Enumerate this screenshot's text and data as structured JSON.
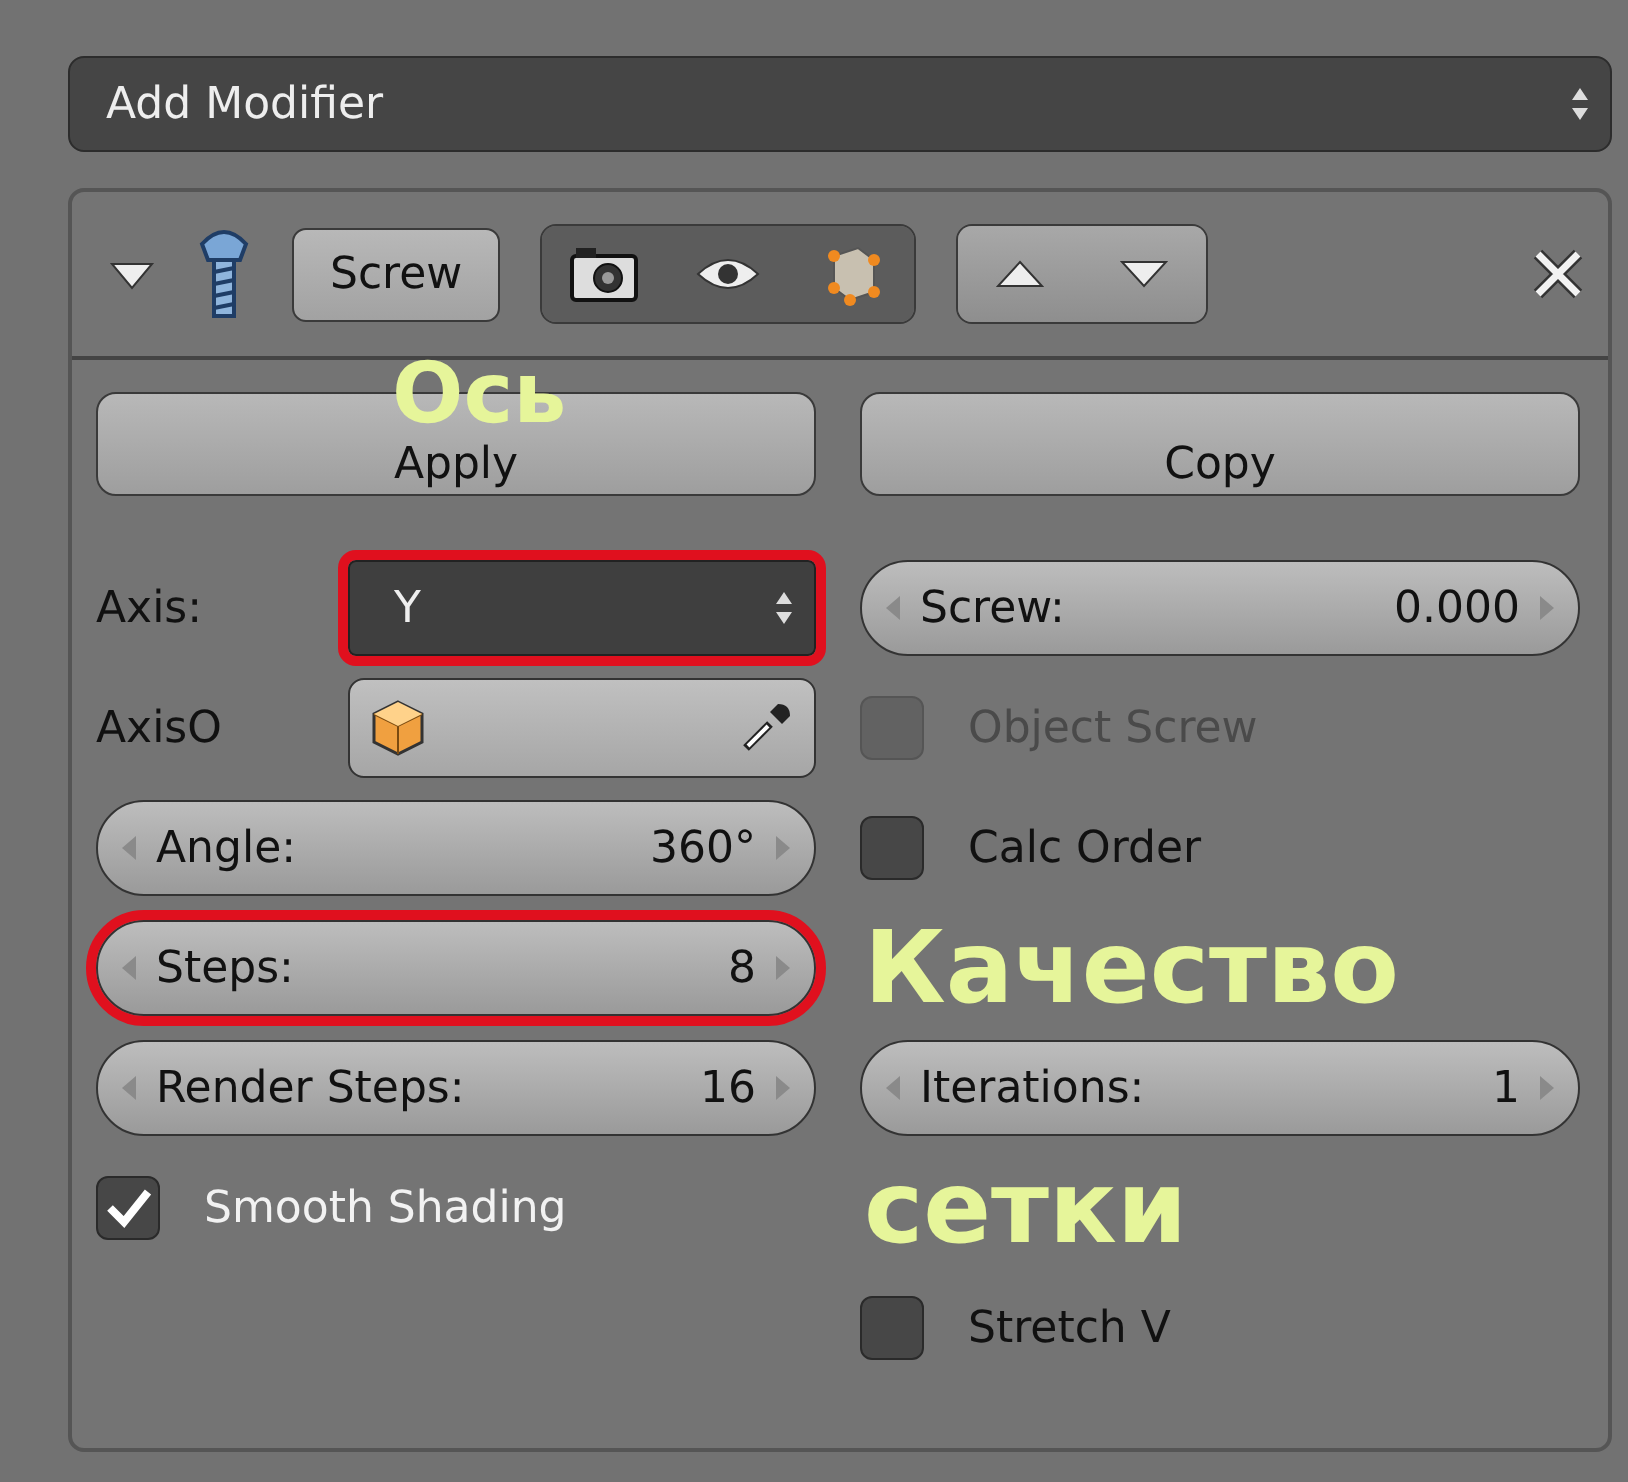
{
  "add_modifier": {
    "label": "Add Modifier"
  },
  "modifier": {
    "expanded": true,
    "name": "Screw"
  },
  "actions": [
    "Apply",
    "Copy"
  ],
  "left": [
    {
      "kind": "dropdown",
      "label": "Axis:",
      "value": "Y",
      "highlighted": true
    },
    {
      "kind": "object",
      "label": "AxisO",
      "highlighted": false
    },
    {
      "kind": "number",
      "label": "Angle:",
      "value": "360°",
      "highlighted": false
    },
    {
      "kind": "number",
      "label": "Steps:",
      "value": "8",
      "highlighted": true
    },
    {
      "kind": "number",
      "label": "Render Steps:",
      "value": "16",
      "highlighted": false
    },
    {
      "kind": "checkbox",
      "label": "Smooth Shading",
      "checked": true,
      "disabled": false
    }
  ],
  "right": [
    {
      "kind": "number",
      "label": "Screw:",
      "value": "0.000",
      "highlighted": false
    },
    {
      "kind": "checkbox",
      "label": "Object Screw",
      "checked": false,
      "disabled": true
    },
    {
      "kind": "checkbox",
      "label": "Calc Order",
      "checked": false,
      "disabled": false
    },
    {
      "kind": "annotation",
      "text": "Качество"
    },
    {
      "kind": "number",
      "label": "Iterations:",
      "value": "1",
      "highlighted": false
    },
    {
      "kind": "annotation",
      "text": "сетки"
    },
    {
      "kind": "checkbox",
      "label": "Stretch V",
      "checked": false,
      "disabled": false
    }
  ],
  "annotations": [
    {
      "text": "Ось"
    }
  ]
}
